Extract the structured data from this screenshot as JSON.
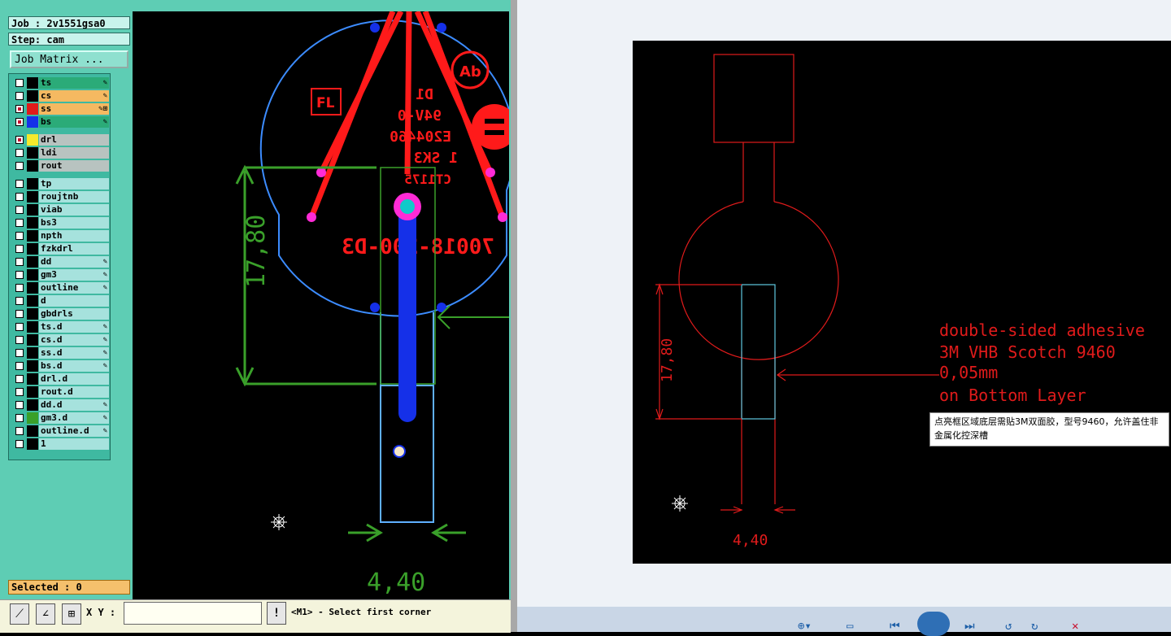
{
  "app": {
    "job_label": "Job : 2v1551gsa0",
    "step_label": "Step: cam",
    "job_matrix_button": "Job Matrix ...",
    "selected_label": "Selected : 0",
    "xy_label": "X Y :",
    "xy_input_value": "",
    "exclaim_label": "!",
    "status_message": "<M1> - Select first corner"
  },
  "layers": [
    {
      "name": "ts",
      "bg": "#2bab78",
      "color": "#000000",
      "checked": false,
      "marks": "✎"
    },
    {
      "name": "cs",
      "bg": "#f5b961",
      "color": "#000000",
      "checked": false,
      "marks": "✎"
    },
    {
      "name": "ss",
      "bg": "#f5b961",
      "color": "#e01b1b",
      "checked": true,
      "marks": "✎⊞"
    },
    {
      "name": "bs",
      "bg": "#2bab78",
      "color": "#1530e8",
      "checked": true,
      "marks": "✎"
    },
    {
      "name": "drl",
      "bg": "#b8c3c0",
      "color": "#f5ea2c",
      "checked": true,
      "marks": ""
    },
    {
      "name": "ldi",
      "bg": "#b8c3c0",
      "color": "#000000",
      "checked": false,
      "marks": ""
    },
    {
      "name": "rout",
      "bg": "#b8c3c0",
      "color": "#000000",
      "checked": false,
      "marks": ""
    },
    {
      "name": "tp",
      "bg": "#a6e2dd",
      "color": "#000000",
      "checked": false,
      "marks": ""
    },
    {
      "name": "roujtnb",
      "bg": "#a6e2dd",
      "color": "#000000",
      "checked": false,
      "marks": ""
    },
    {
      "name": "viab",
      "bg": "#a6e2dd",
      "color": "#000000",
      "checked": false,
      "marks": ""
    },
    {
      "name": "bs3",
      "bg": "#a6e2dd",
      "color": "#000000",
      "checked": false,
      "marks": ""
    },
    {
      "name": "npth",
      "bg": "#a6e2dd",
      "color": "#000000",
      "checked": false,
      "marks": ""
    },
    {
      "name": "fzkdrl",
      "bg": "#a6e2dd",
      "color": "#000000",
      "checked": false,
      "marks": ""
    },
    {
      "name": "dd",
      "bg": "#a6e2dd",
      "color": "#000000",
      "checked": false,
      "marks": "✎"
    },
    {
      "name": "gm3",
      "bg": "#a6e2dd",
      "color": "#000000",
      "checked": false,
      "marks": "✎"
    },
    {
      "name": "outline",
      "bg": "#a6e2dd",
      "color": "#000000",
      "checked": false,
      "marks": "✎"
    },
    {
      "name": "d",
      "bg": "#a6e2dd",
      "color": "#000000",
      "checked": false,
      "marks": ""
    },
    {
      "name": "gbdrls",
      "bg": "#a6e2dd",
      "color": "#000000",
      "checked": false,
      "marks": ""
    },
    {
      "name": "ts.d",
      "bg": "#a6e2dd",
      "color": "#000000",
      "checked": false,
      "marks": "✎"
    },
    {
      "name": "cs.d",
      "bg": "#a6e2dd",
      "color": "#000000",
      "checked": false,
      "marks": "✎"
    },
    {
      "name": "ss.d",
      "bg": "#a6e2dd",
      "color": "#000000",
      "checked": false,
      "marks": "✎"
    },
    {
      "name": "bs.d",
      "bg": "#a6e2dd",
      "color": "#000000",
      "checked": false,
      "marks": "✎"
    },
    {
      "name": "drl.d",
      "bg": "#a6e2dd",
      "color": "#000000",
      "checked": false,
      "marks": ""
    },
    {
      "name": "rout.d",
      "bg": "#a6e2dd",
      "color": "#000000",
      "checked": false,
      "marks": ""
    },
    {
      "name": "dd.d",
      "bg": "#a6e2dd",
      "color": "#000000",
      "checked": false,
      "marks": "✎"
    },
    {
      "name": "gm3.d",
      "bg": "#a6e2dd",
      "color": "#3aa02a",
      "checked": false,
      "marks": "✎"
    },
    {
      "name": "outline.d",
      "bg": "#a6e2dd",
      "color": "#000000",
      "checked": false,
      "marks": "✎"
    },
    {
      "name": "1",
      "bg": "#a6e2dd",
      "color": "#000000",
      "checked": false,
      "marks": ""
    }
  ],
  "cam_view": {
    "text_d1": "D1",
    "text_94v0": "94V-0",
    "text_e204460": "E204460",
    "text_5k3": "1 SK3",
    "text_ct": "CT1175",
    "text_partno": "70018-200-D3",
    "text_fl": "FL",
    "dim_vertical": "17,80",
    "dim_horizontal": "4,40"
  },
  "drawing_view": {
    "dim_vertical": "17,80",
    "dim_horizontal": "4,40",
    "annotation_lines": [
      "double-sided adhesive",
      "3M VHB Scotch 9460",
      "0,05mm",
      "on Bottom Layer"
    ],
    "note_text": "点亮框区域底层需贴3M双面胶，型号9460，允许盖住非金属化控深槽"
  },
  "colors": {
    "trace_red": "#ff1a1a",
    "outline_blue": "#3c8cff",
    "dim_green": "#3aa02a",
    "draw_red": "#e01b1b",
    "highlight_cyan": "#5fc8e0"
  },
  "viewer_controls": [
    "zoom-icon",
    "prev-icon",
    "play-icon",
    "next-icon",
    "rotate-left-icon",
    "rotate-right-icon",
    "delete-icon"
  ]
}
